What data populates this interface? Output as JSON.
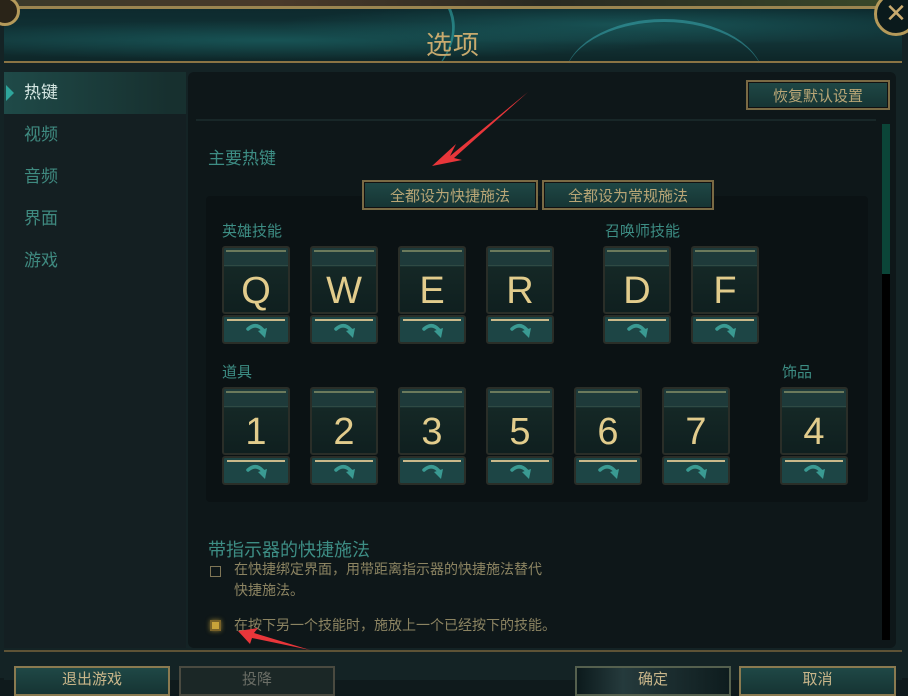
{
  "window": {
    "title": "选项",
    "close_icon": "close-icon"
  },
  "sidebar": {
    "items": [
      {
        "label": "热键",
        "active": true
      },
      {
        "label": "视频",
        "active": false
      },
      {
        "label": "音频",
        "active": false
      },
      {
        "label": "界面",
        "active": false
      },
      {
        "label": "游戏",
        "active": false
      }
    ]
  },
  "main": {
    "reset_label": "恢复默认设置",
    "primary_hotkeys_title": "主要热键",
    "set_all_quick_label": "全都设为快捷施法",
    "set_all_normal_label": "全都设为常规施法",
    "champion_abilities": {
      "label": "英雄技能",
      "keys": [
        "Q",
        "W",
        "E",
        "R"
      ]
    },
    "summoner_spells": {
      "label": "召唤师技能",
      "keys": [
        "D",
        "F"
      ]
    },
    "items": {
      "label": "道具",
      "keys": [
        "1",
        "2",
        "3",
        "5",
        "6",
        "7"
      ]
    },
    "trinket": {
      "label": "饰品",
      "keys": [
        "4"
      ]
    },
    "cast_mode_icon": "curved-arrow-icon",
    "indicator_section": {
      "title": "带指示器的快捷施法",
      "options": [
        {
          "text_line1": "在快捷绑定界面，用带距离指示器的快捷施法替代",
          "text_line2": "快捷施法。",
          "checked": false
        },
        {
          "text_line1": "在按下另一个技能时，施放上一个已经按下的技能。",
          "checked": true
        }
      ]
    },
    "scroll_position": 0
  },
  "footer": {
    "buttons": [
      {
        "label": "退出游戏",
        "state": "normal"
      },
      {
        "label": "投降",
        "state": "disabled"
      },
      {
        "label": "确定",
        "state": "dark"
      },
      {
        "label": "取消",
        "state": "normal"
      }
    ]
  },
  "annotations": {
    "arrow_color": "#e8363a"
  },
  "colors": {
    "gold": "#c8aa6e",
    "teal_text": "#3d8d84",
    "key_letter": "#e2cc8c"
  }
}
